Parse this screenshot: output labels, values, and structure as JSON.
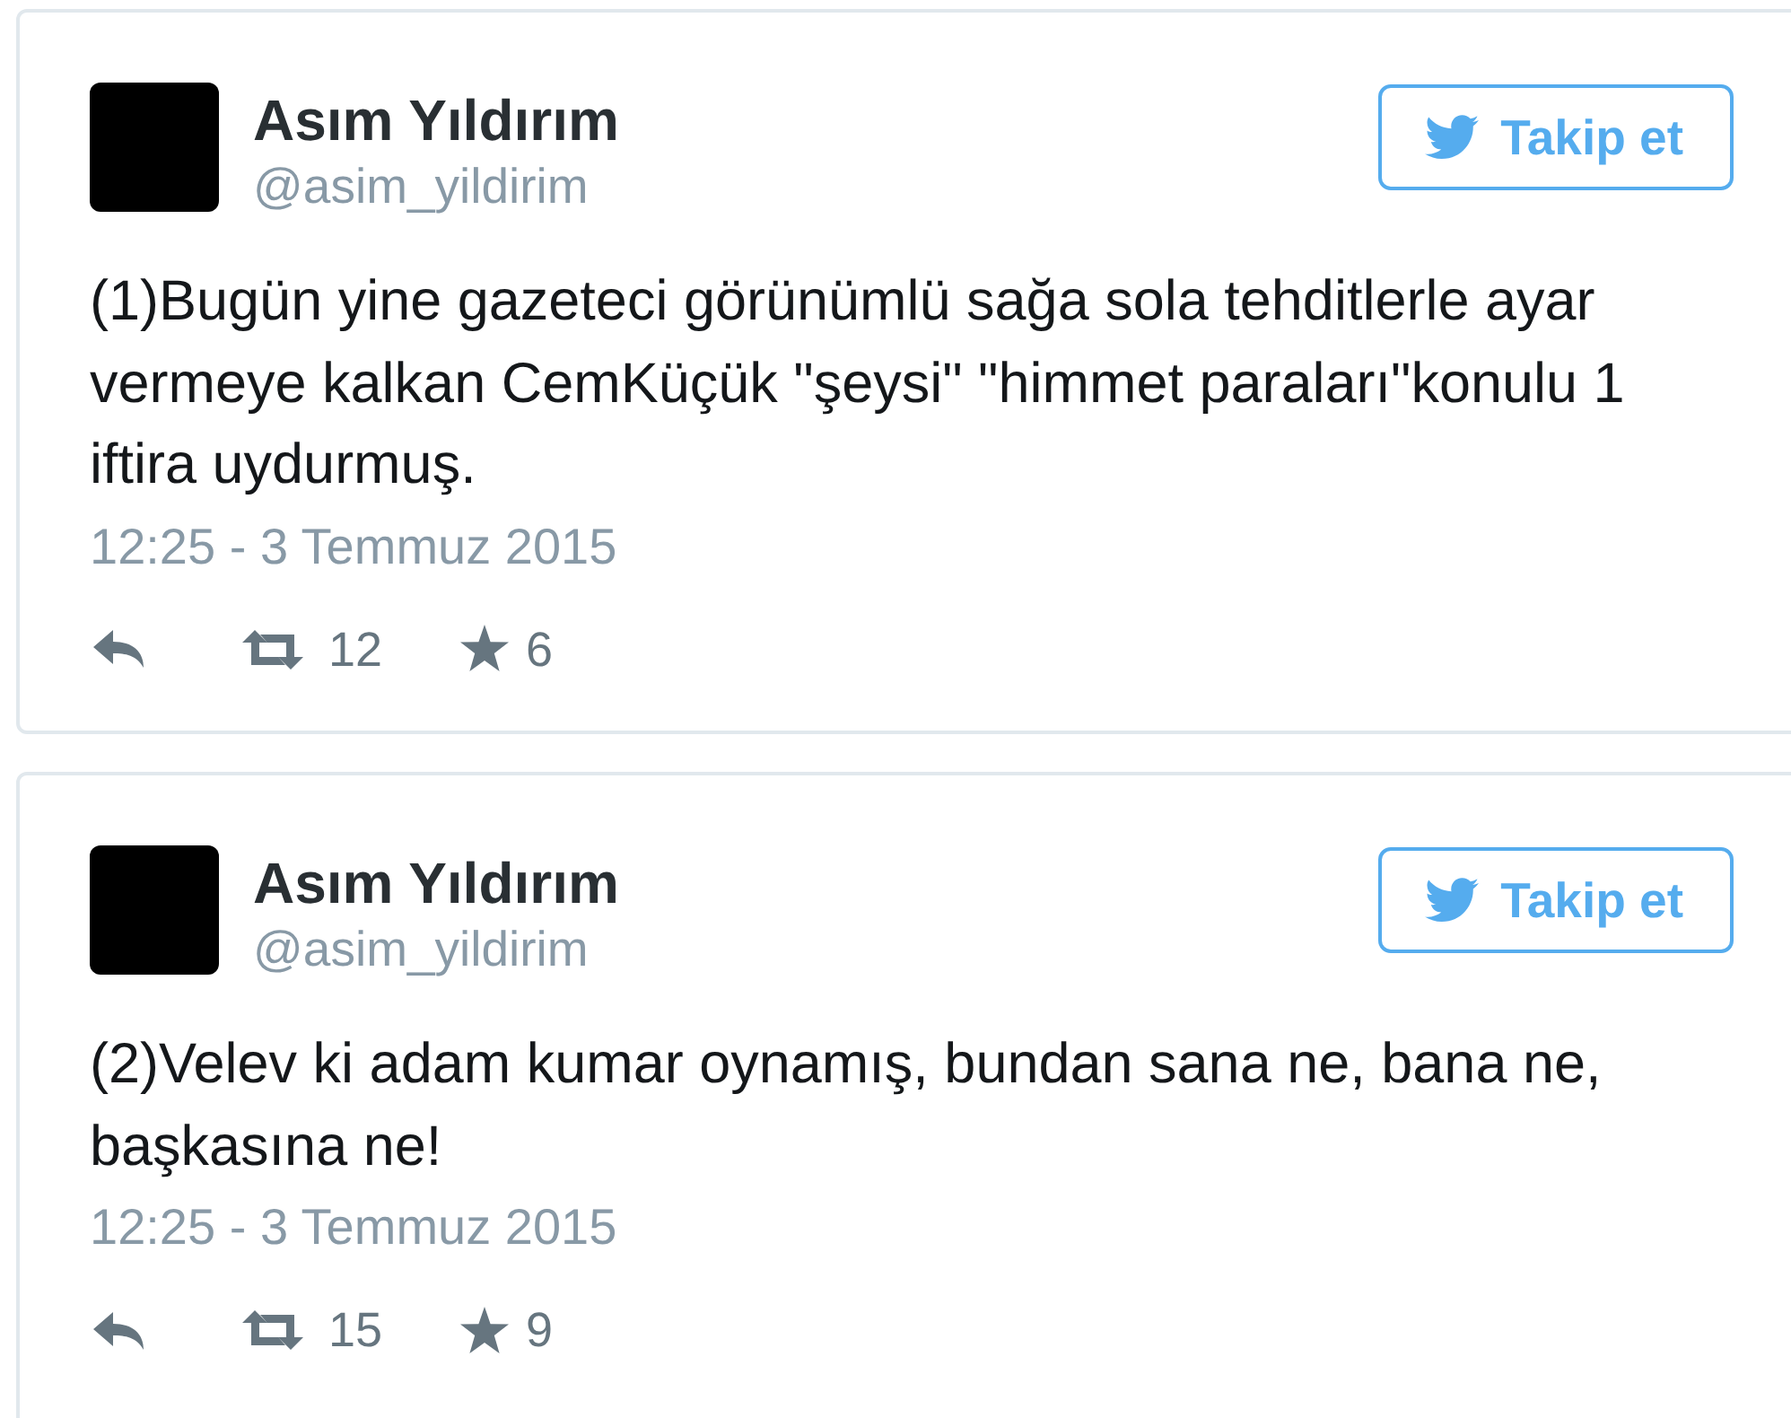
{
  "tweets": [
    {
      "author": {
        "name": "Asım Yıldırım",
        "handle": "@asim_yildirim"
      },
      "follow_button": {
        "label": "Takip et"
      },
      "text": "(1)Bugün yine gazeteci görünümlü sağa sola tehditlerle ayar vermeye kalkan CemKüçük \"şeysi\" \"himmet paraları\"konulu 1 iftira uydurmuş.",
      "timestamp": "12:25 - 3 Temmuz 2015",
      "retweet_count": "12",
      "favorite_count": "6"
    },
    {
      "author": {
        "name": "Asım Yıldırım",
        "handle": "@asim_yildirim"
      },
      "follow_button": {
        "label": "Takip et"
      },
      "text": "(2)Velev ki adam kumar oynamış, bundan sana ne, bana ne, başkasına ne!",
      "timestamp": "12:25 - 3 Temmuz 2015",
      "retweet_count": "15",
      "favorite_count": "9"
    }
  ]
}
